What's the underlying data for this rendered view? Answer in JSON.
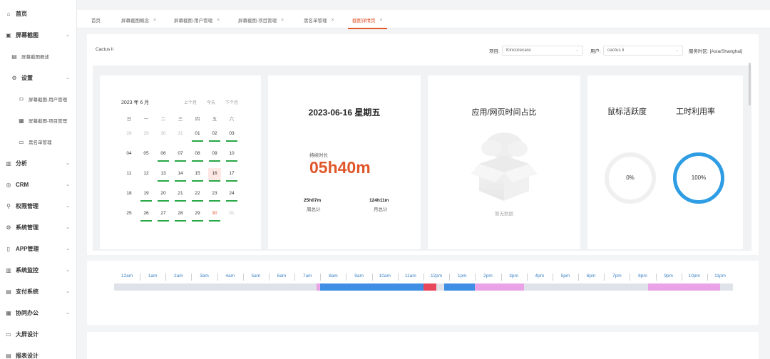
{
  "sidebar": {
    "items": [
      {
        "label": "首页",
        "icon": "home-icon",
        "glyph": "⌂",
        "arrow": false
      },
      {
        "label": "屏幕截图",
        "icon": "screenshot-icon",
        "glyph": "▣",
        "arrow": true
      },
      {
        "label": "屏幕截图概述",
        "icon": "doc-icon",
        "glyph": "▤",
        "arrow": false
      },
      {
        "label": "设置",
        "icon": "gear-icon",
        "glyph": "⚙",
        "arrow": true
      },
      {
        "label": "屏幕截图-用户管理",
        "icon": "user-icon",
        "glyph": "⚇",
        "arrow": false
      },
      {
        "label": "屏幕截图-项目管理",
        "icon": "grid-icon",
        "glyph": "▦",
        "arrow": false
      },
      {
        "label": "黑名单管理",
        "icon": "monitor-icon",
        "glyph": "▭",
        "arrow": false
      },
      {
        "label": "分析",
        "icon": "chart-icon",
        "glyph": "▥",
        "arrow": true
      },
      {
        "label": "CRM",
        "icon": "crm-icon",
        "glyph": "◎",
        "arrow": true
      },
      {
        "label": "权限管理",
        "icon": "permission-icon",
        "glyph": "⚲",
        "arrow": true
      },
      {
        "label": "系统管理",
        "icon": "system-icon",
        "glyph": "⚙",
        "arrow": true
      },
      {
        "label": "APP管理",
        "icon": "app-icon",
        "glyph": "▯",
        "arrow": true
      },
      {
        "label": "系统监控",
        "icon": "monitor-chart-icon",
        "glyph": "▥",
        "arrow": true
      },
      {
        "label": "支付系统",
        "icon": "payment-icon",
        "glyph": "▤",
        "arrow": true
      },
      {
        "label": "协同办公",
        "icon": "office-icon",
        "glyph": "▦",
        "arrow": true
      },
      {
        "label": "大屏设计",
        "icon": "screen-icon",
        "glyph": "▭",
        "arrow": false
      },
      {
        "label": "报表设计",
        "icon": "report-icon",
        "glyph": "▤",
        "arrow": false
      }
    ]
  },
  "tabs": [
    {
      "label": "首页",
      "closable": false,
      "active": false
    },
    {
      "label": "屏幕截图概念",
      "closable": true,
      "active": false
    },
    {
      "label": "屏幕截图-用户管理",
      "closable": true,
      "active": false
    },
    {
      "label": "屏幕截图-项目管理",
      "closable": true,
      "active": false
    },
    {
      "label": "黑名单管理",
      "closable": true,
      "active": false
    },
    {
      "label": "截图详情页",
      "closable": true,
      "active": true
    }
  ],
  "filters": {
    "breadcrumb": "Cactus li",
    "project_label": "项目:",
    "project_value": "Kincorecare",
    "user_label": "用户:",
    "user_value": "cactus li",
    "timezone": "服务时区: [Asia/Shanghai]"
  },
  "calendar": {
    "title": "2023 年 6 月",
    "nav": [
      "上个月",
      "今天",
      "下个月"
    ],
    "weekdays": [
      "日",
      "一",
      "二",
      "三",
      "四",
      "五",
      "六"
    ],
    "week_numbers": [
      "",
      "04",
      "11",
      "18",
      "25"
    ],
    "rows": [
      [
        {
          "d": "28",
          "m": true
        },
        {
          "d": "29",
          "m": true
        },
        {
          "d": "30",
          "m": true
        },
        {
          "d": "31",
          "m": true
        },
        {
          "d": "01",
          "b": true
        },
        {
          "d": "02",
          "b": true
        },
        {
          "d": "03",
          "b": true
        }
      ],
      [
        {
          "d": "04"
        },
        {
          "d": "05"
        },
        {
          "d": "06",
          "b": true
        },
        {
          "d": "07",
          "b": true
        },
        {
          "d": "08",
          "b": true
        },
        {
          "d": "09",
          "b": true
        },
        {
          "d": "10",
          "b": true
        }
      ],
      [
        {
          "d": "11"
        },
        {
          "d": "12"
        },
        {
          "d": "13",
          "b": true
        },
        {
          "d": "14",
          "b": true
        },
        {
          "d": "15",
          "b": true
        },
        {
          "d": "16",
          "b": true,
          "t": true
        },
        {
          "d": "17",
          "b": true
        }
      ],
      [
        {
          "d": "18"
        },
        {
          "d": "19",
          "b": true
        },
        {
          "d": "20",
          "b": true
        },
        {
          "d": "21",
          "b": true
        },
        {
          "d": "22",
          "b": true
        },
        {
          "d": "23",
          "b": true
        },
        {
          "d": "24",
          "b": true
        }
      ],
      [
        {
          "d": "25"
        },
        {
          "d": "26",
          "b": true
        },
        {
          "d": "27",
          "b": true
        },
        {
          "d": "28",
          "b": true
        },
        {
          "d": "29",
          "b": true
        },
        {
          "d": "30",
          "b": true,
          "m2": true
        },
        {
          "d": "01",
          "m": true
        }
      ]
    ]
  },
  "day": {
    "date": "2023-06-16 星期五",
    "hold_label": "持续时长",
    "hold_value": "05h40m",
    "week_total": "25h07m",
    "week_label": "周总计",
    "month_total": "124h11m",
    "month_label": "月总计"
  },
  "app_ratio": {
    "title": "应用/网页时间占比",
    "empty": "暂无数据"
  },
  "gauges": {
    "mouse_title": "鼠标活跃度",
    "mouse_value": "0%",
    "work_title": "工时利用率",
    "work_value": "100%",
    "accent": "#2f9de4"
  },
  "timeline": {
    "hours": [
      "12am",
      "1am",
      "2am",
      "3am",
      "4am",
      "5am",
      "6am",
      "7am",
      "8am",
      "9am",
      "10am",
      "11am",
      "12pm",
      "1pm",
      "2pm",
      "3pm",
      "4pm",
      "5pm",
      "6pm",
      "7pm",
      "8pm",
      "9pm",
      "10pm",
      "11pm"
    ],
    "segments": [
      {
        "start": 7.35,
        "end": 7.5,
        "color": "#e9a3e6"
      },
      {
        "start": 7.5,
        "end": 11.5,
        "color": "#3e8ee6"
      },
      {
        "start": 11.5,
        "end": 12.0,
        "color": "#e8475b"
      },
      {
        "start": 12.3,
        "end": 13.5,
        "color": "#3e8ee6"
      },
      {
        "start": 13.5,
        "end": 15.4,
        "color": "#e9a3e6"
      },
      {
        "start": 20.2,
        "end": 23.0,
        "color": "#e9a3e6"
      }
    ]
  }
}
